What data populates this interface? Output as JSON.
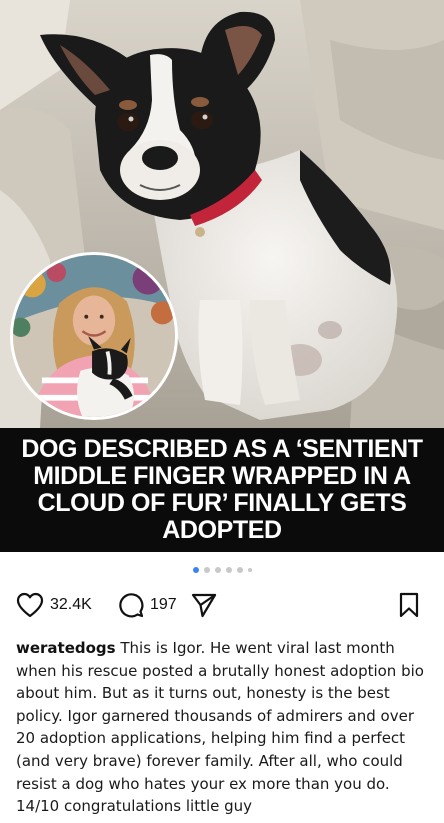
{
  "post": {
    "headline": "DOG DESCRIBED AS A ‘SENTIENT MIDDLE FINGER WRAPPED IN A CLOUD OF FUR’ FINALLY GETS ADOPTED",
    "carousel": {
      "current": 1,
      "dots_visible": 6
    }
  },
  "actions": {
    "like_icon": "heart-outline-icon",
    "likes": "32.4K",
    "comment_icon": "speech-bubble-icon",
    "comments": "197",
    "share_icon": "paper-plane-icon",
    "save_icon": "bookmark-outline-icon"
  },
  "caption": {
    "username": "weratedogs",
    "text": "This is Igor. He went viral last month when his rescue posted a brutally honest adoption bio about him. But as it turns out, honesty is the best policy. Igor garnered thousands of admirers and over 20 adoption applications, helping him find a perfect (and very brave) forever family. After all, who could resist a dog who hates your ex more than you do. 14/10 congratulations little guy"
  },
  "colors": {
    "headline_band": "#0b0b0b",
    "dot_active": "#3b82f6",
    "dot_inactive": "#c8c8c8"
  }
}
